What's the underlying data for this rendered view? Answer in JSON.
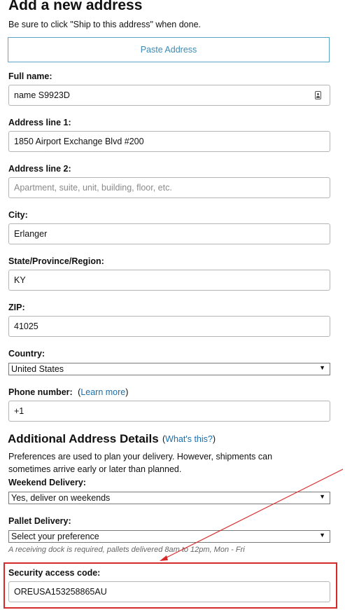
{
  "page": {
    "title": "Add a new address",
    "subtitle": "Be sure to click \"Ship to this address\" when done.",
    "paste_button": "Paste Address"
  },
  "fields": {
    "full_name": {
      "label": "Full name:",
      "value": "name S9923D"
    },
    "address1": {
      "label": "Address line 1:",
      "value": "1850 Airport Exchange Blvd #200"
    },
    "address2": {
      "label": "Address line 2:",
      "value": "",
      "placeholder": "Apartment, suite, unit, building, floor, etc."
    },
    "city": {
      "label": "City:",
      "value": "Erlanger"
    },
    "state": {
      "label": "State/Province/Region:",
      "value": "KY"
    },
    "zip": {
      "label": "ZIP:",
      "value": "41025"
    },
    "country": {
      "label": "Country:",
      "value": "United States"
    },
    "phone": {
      "label": "Phone number:",
      "link_prefix": "(",
      "link_text": "Learn more",
      "link_suffix": ")",
      "value": "+1"
    }
  },
  "additional": {
    "heading": "Additional Address Details",
    "whats_prefix": "(",
    "whats_link": "What's this?",
    "whats_suffix": ")",
    "description": "Preferences are used to plan your delivery. However, shipments can sometimes arrive early or later than planned.",
    "weekend": {
      "label": "Weekend Delivery:",
      "value": "Yes, deliver on weekends"
    },
    "pallet": {
      "label": "Pallet Delivery:",
      "value": "Select your preference"
    },
    "pallet_note": "A receiving dock is required, pallets delivered 8am to 12pm, Mon - Fri",
    "security": {
      "label": "Security access code:",
      "value": "OREUSA153258865AU"
    }
  },
  "annotation": {
    "color": "#d62a2a"
  }
}
